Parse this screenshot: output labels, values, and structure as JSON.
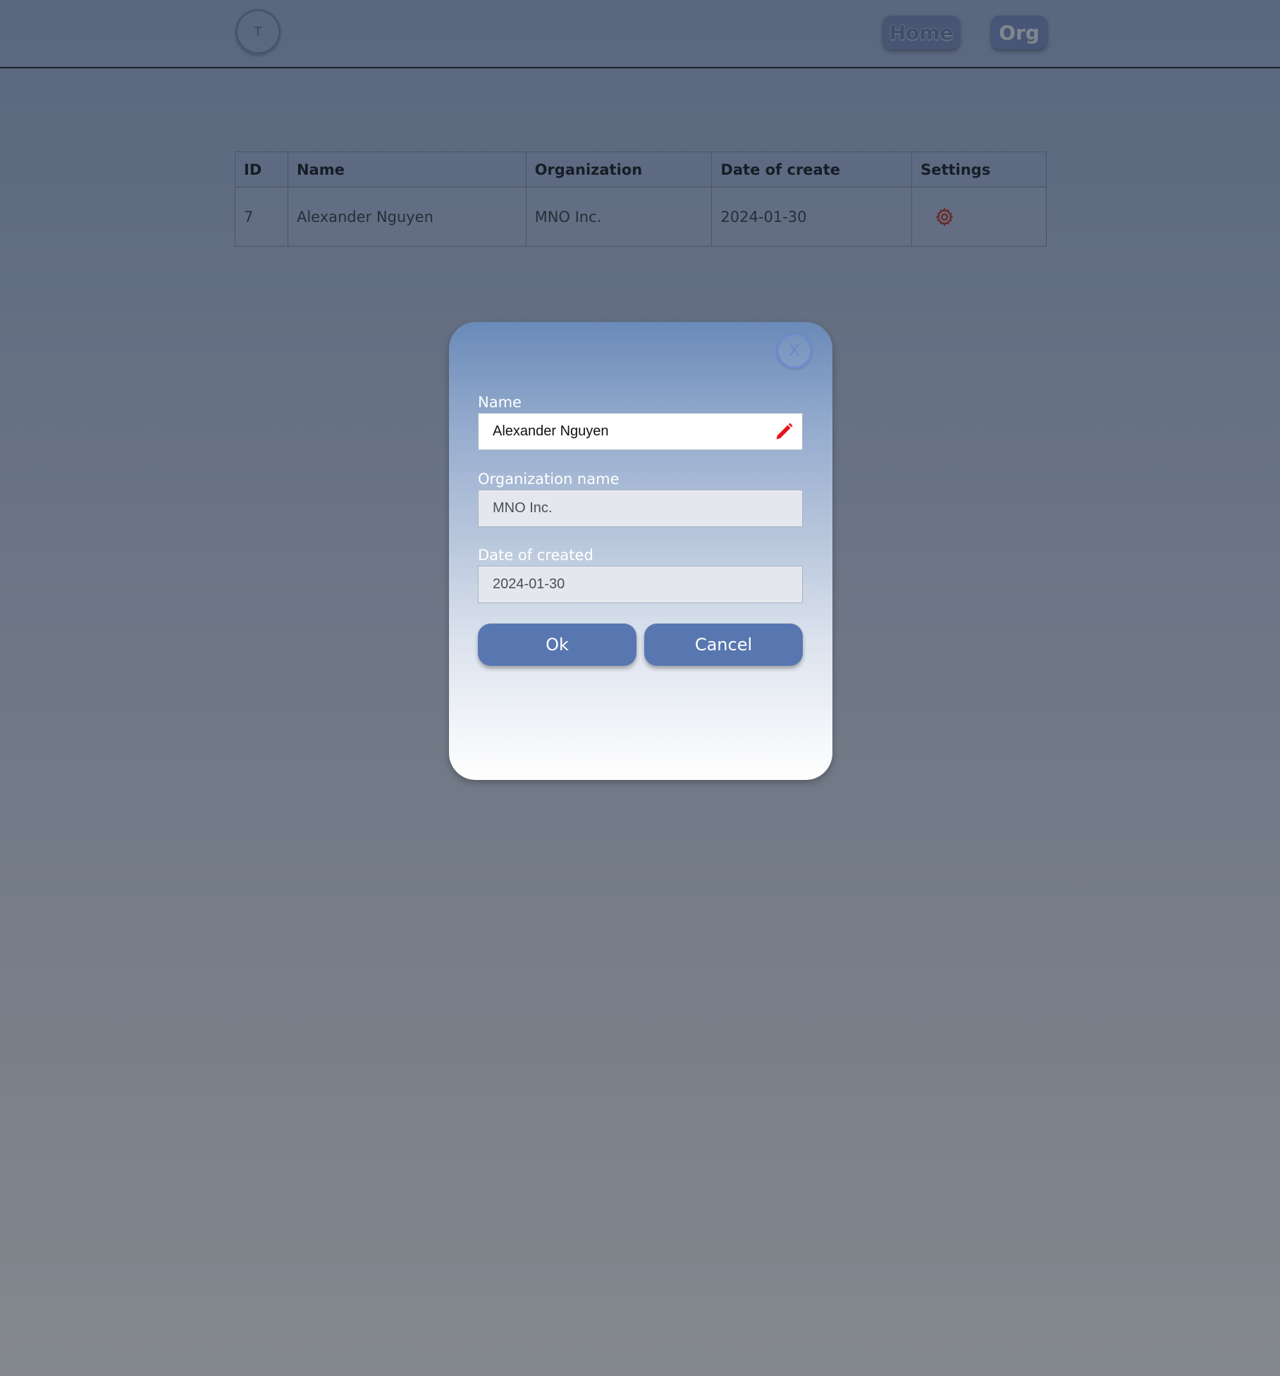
{
  "header": {
    "avatar_initial": "T",
    "nav": {
      "home_label": "Home",
      "org_label": "Org"
    }
  },
  "table": {
    "columns": [
      "ID",
      "Name",
      "Organization",
      "Date of create",
      "Settings"
    ],
    "rows": [
      {
        "id": "7",
        "name": "Alexander Nguyen",
        "organization": "MNO Inc.",
        "date": "2024-01-30",
        "settings_icon": "gear-icon"
      }
    ]
  },
  "modal": {
    "close_label": "X",
    "name_label": "Name",
    "name_value": "Alexander Nguyen",
    "org_label": "Organization name",
    "org_value": "MNO Inc.",
    "date_label": "Date of created",
    "date_value": "2024-01-30",
    "ok_label": "Ok",
    "cancel_label": "Cancel",
    "edit_icon": "pencil-icon"
  },
  "colors": {
    "accent": "#5877b1",
    "edit_icon": "#e8101b",
    "settings_icon": "#c0392b"
  }
}
